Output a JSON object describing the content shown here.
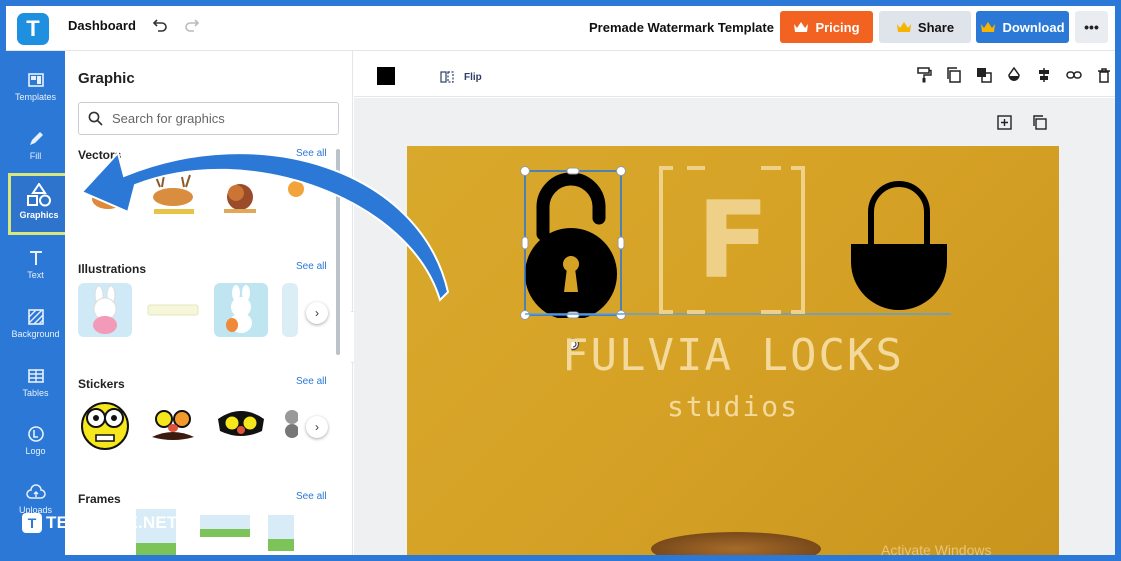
{
  "topbar": {
    "logo_letter": "T",
    "title": "Dashboard",
    "document_title": "Premade Watermark Template",
    "pricing_label": "Pricing",
    "share_label": "Share",
    "download_label": "Download",
    "more_label": "•••"
  },
  "rail": {
    "items": [
      {
        "label": "Templates",
        "icon": "templates-icon"
      },
      {
        "label": "Fill",
        "icon": "fill-icon"
      },
      {
        "label": "Graphics",
        "icon": "graphics-icon",
        "active": true
      },
      {
        "label": "Text",
        "icon": "text-icon"
      },
      {
        "label": "Background",
        "icon": "background-icon"
      },
      {
        "label": "Tables",
        "icon": "tables-icon"
      },
      {
        "label": "Logo",
        "icon": "logo-icon"
      },
      {
        "label": "Uploads",
        "icon": "uploads-icon"
      }
    ],
    "footer_logo_letter": "T",
    "footer_brand": "TEMPLATE.NET"
  },
  "panel": {
    "title": "Graphic",
    "search_placeholder": "Search for graphics",
    "sections": [
      {
        "title": "Vectors",
        "see_all": "See all"
      },
      {
        "title": "Illustrations",
        "see_all": "See all"
      },
      {
        "title": "Stickers",
        "see_all": "See all"
      },
      {
        "title": "Frames",
        "see_all": "See all"
      }
    ]
  },
  "toolbar": {
    "flip_label": "Flip"
  },
  "canvas": {
    "monogram": "F",
    "brand_name": "FULVIA LOCKS",
    "brand_sub": "studios",
    "watermark_text": "Activate Windows"
  },
  "colors": {
    "accent": "#2b78d6",
    "pricing": "#f26322",
    "design_bg": "#d6a226",
    "highlight_border": "#d8e67e"
  }
}
